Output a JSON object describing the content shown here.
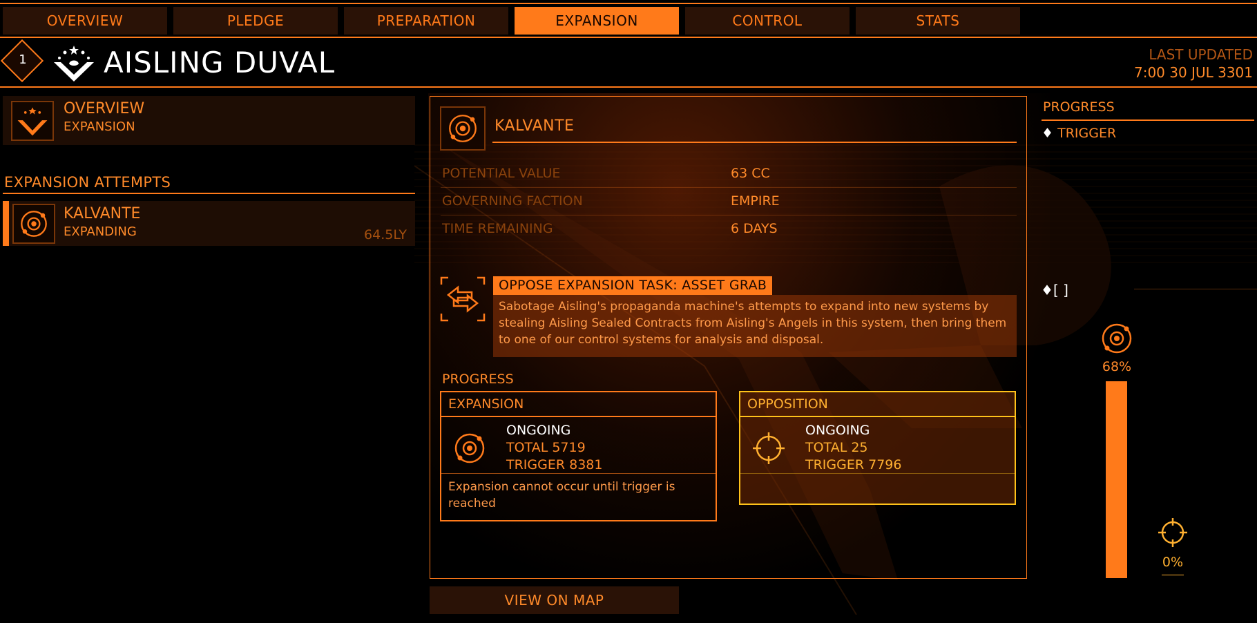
{
  "tabs": [
    {
      "label": "OVERVIEW",
      "active": false
    },
    {
      "label": "PLEDGE",
      "active": false
    },
    {
      "label": "PREPARATION",
      "active": false
    },
    {
      "label": "EXPANSION",
      "active": true
    },
    {
      "label": "CONTROL",
      "active": false
    },
    {
      "label": "STATS",
      "active": false
    }
  ],
  "header": {
    "rank": "1",
    "power_name": "AISLING DUVAL",
    "last_updated_label": "LAST UPDATED",
    "last_updated_value": "7:00 30 JUL 3301"
  },
  "left": {
    "overview_title": "OVERVIEW",
    "overview_subtitle": "EXPANSION",
    "section_title": "EXPANSION ATTEMPTS",
    "attempts": [
      {
        "name": "KALVANTE",
        "status": "EXPANDING",
        "distance": "64.5LY"
      }
    ]
  },
  "detail": {
    "system_name": "KALVANTE",
    "rows": [
      {
        "label": "POTENTIAL VALUE",
        "value": "63 CC"
      },
      {
        "label": "GOVERNING FACTION",
        "value": "EMPIRE"
      },
      {
        "label": "TIME REMAINING",
        "value": "6 DAYS"
      }
    ],
    "task_title": "OPPOSE EXPANSION TASK: ASSET GRAB",
    "task_description": "Sabotage Aisling's propaganda machine's attempts to expand into new systems by stealing Aisling Sealed Contracts from Aisling's Angels in this system, then bring them to one of our control systems for analysis and disposal.",
    "progress_label": "PROGRESS",
    "expansion": {
      "header": "EXPANSION",
      "status": "ONGOING",
      "total": "TOTAL 5719",
      "trigger": "TRIGGER 8381",
      "note": "Expansion cannot occur until trigger is reached"
    },
    "opposition": {
      "header": "OPPOSITION",
      "status": "ONGOING",
      "total": "TOTAL 25",
      "trigger": "TRIGGER 7796"
    },
    "view_on_map": "VIEW ON MAP"
  },
  "right": {
    "title": "PROGRESS",
    "trigger_label": "TRIGGER",
    "trigger_marker": "[ ]",
    "expansion_percent": "68%",
    "expansion_fraction": 0.68,
    "opposition_percent": "0%",
    "opposition_fraction": 0.0
  },
  "colors": {
    "accent": "#ff7a1a",
    "opposition": "#ffc21a",
    "tab_bg": "#2a1206"
  }
}
